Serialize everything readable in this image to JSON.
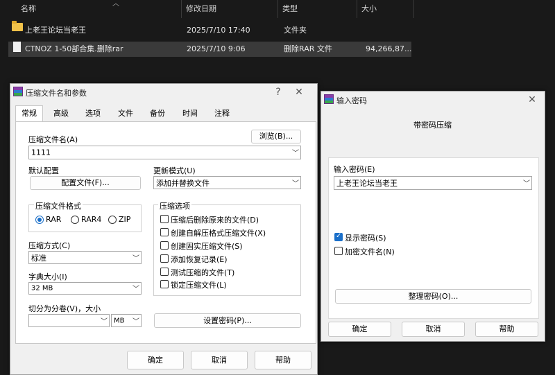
{
  "explorer": {
    "columns": [
      "名称",
      "修改日期",
      "类型",
      "大小"
    ],
    "rows": [
      {
        "name": "上老王论坛当老王",
        "date": "2025/7/10 17:40",
        "type": "文件夹",
        "size": "",
        "icon": "folder-icon"
      },
      {
        "name": "CTNOZ 1-50部合集.删除rar",
        "date": "2025/7/10 9:06",
        "type": "删除RAR 文件",
        "size": "94,266,87...",
        "icon": "file-icon"
      }
    ]
  },
  "archive_dialog": {
    "title": "压缩文件名和参数",
    "help_glyph": "?",
    "close_glyph": "✕",
    "tabs": [
      "常规",
      "高级",
      "选项",
      "文件",
      "备份",
      "时间",
      "注释"
    ],
    "filename_label": "压缩文件名(A)",
    "browse_button": "浏览(B)...",
    "filename_value": "1111",
    "default_config_label": "默认配置",
    "profiles_button": "配置文件(F)...",
    "update_mode_label": "更新模式(U)",
    "update_mode_value": "添加并替换文件",
    "format_group_label": "压缩文件格式",
    "formats": [
      "RAR",
      "RAR4",
      "ZIP"
    ],
    "selected_format": "RAR",
    "options_group_label": "压缩选项",
    "options": [
      {
        "label": "压缩后删除原来的文件(D)",
        "checked": false
      },
      {
        "label": "创建自解压格式压缩文件(X)",
        "checked": false
      },
      {
        "label": "创建固实压缩文件(S)",
        "checked": false
      },
      {
        "label": "添加恢复记录(E)",
        "checked": false
      },
      {
        "label": "测试压缩的文件(T)",
        "checked": false
      },
      {
        "label": "锁定压缩文件(L)",
        "checked": false
      }
    ],
    "method_label": "压缩方式(C)",
    "method_value": "标准",
    "dict_label": "字典大小(I)",
    "dict_value": "32 MB",
    "split_label": "切分为分卷(V)，大小",
    "split_value": "",
    "split_unit": "MB",
    "set_password_button": "设置密码(P)...",
    "ok_button": "确定",
    "cancel_button": "取消",
    "help_button": "帮助"
  },
  "password_dialog": {
    "title": "输入密码",
    "close_glyph": "✕",
    "header_text": "带密码压缩",
    "password_label": "输入密码(E)",
    "password_value": "上老王论坛当老王",
    "show_password_label": "显示密码(S)",
    "show_password_checked": true,
    "encrypt_names_label": "加密文件名(N)",
    "encrypt_names_checked": false,
    "organize_button": "整理密码(O)...",
    "ok_button": "确定",
    "cancel_button": "取消",
    "help_button": "帮助"
  },
  "colors": {
    "explorer_bg": "#191919",
    "dialog_bg": "#f0f0f0",
    "accent": "#1a6fc9",
    "folder": "#f1c24a"
  }
}
